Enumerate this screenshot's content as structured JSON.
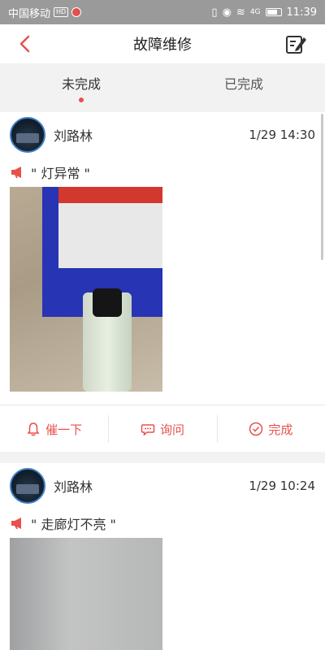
{
  "status_bar": {
    "carrier": "中国移动",
    "hd_badge": "HD",
    "time": "11:39",
    "signal_text": "4G"
  },
  "header": {
    "title": "故障维修"
  },
  "tabs": [
    {
      "label": "未完成",
      "active": true
    },
    {
      "label": "已完成",
      "active": false
    }
  ],
  "cards": [
    {
      "user": "刘路林",
      "time": "1/29 14:30",
      "description": "\" 灯异常 \"",
      "actions": {
        "remind": "催一下",
        "inquire": "询问",
        "complete": "完成"
      }
    },
    {
      "user": "刘路林",
      "time": "1/29 10:24",
      "description": "\" 走廊灯不亮 \""
    }
  ],
  "colors": {
    "accent": "#e8504c",
    "status_bar": "#9a9a9a",
    "background": "#f2f2f2"
  },
  "icons": {
    "back": "chevron-left-icon",
    "edit": "edit-note-icon",
    "horn": "megaphone-icon",
    "remind": "bell-icon",
    "inquire": "chat-bubble-icon",
    "complete": "check-circle-icon"
  }
}
